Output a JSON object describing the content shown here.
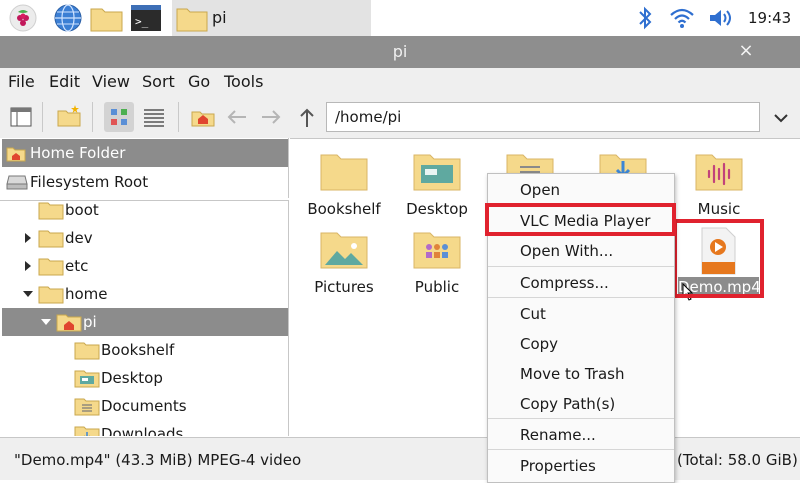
{
  "taskbar": {
    "launcher_icons": [
      "raspberry-icon",
      "web-browser-icon",
      "file-manager-icon",
      "terminal-icon"
    ],
    "open_window": {
      "label": "pi",
      "icon": "folder-icon"
    },
    "tray_icons": [
      "bluetooth-icon",
      "wifi-icon",
      "volume-icon"
    ],
    "clock": "19:43"
  },
  "window": {
    "title": "pi",
    "close_glyph": "×"
  },
  "menubar": {
    "items": [
      "File",
      "Edit",
      "View",
      "Sort",
      "Go",
      "Tools"
    ]
  },
  "toolbar": {
    "path": "/home/pi",
    "buttons": [
      "sidepane-icon",
      "new-folder-icon",
      "icon-view-icon",
      "list-view-icon",
      "home-icon",
      "back-arrow-icon",
      "forward-arrow-icon",
      "up-arrow-icon"
    ],
    "history_dropdown_glyph": "⌄"
  },
  "sidebar": {
    "places": [
      {
        "label": "Home Folder",
        "icon": "home-icon",
        "selected": true
      },
      {
        "label": "Filesystem Root",
        "icon": "drive-icon",
        "selected": false
      }
    ],
    "tree": [
      {
        "label": "boot"
      },
      {
        "label": "dev"
      },
      {
        "label": "etc"
      },
      {
        "label": "home"
      },
      {
        "label": "pi"
      },
      {
        "label": "Bookshelf"
      },
      {
        "label": "Desktop"
      },
      {
        "label": "Documents"
      },
      {
        "label": "Downloads"
      }
    ]
  },
  "files": [
    {
      "label": "Bookshelf",
      "icon": "folder-icon"
    },
    {
      "label": "Desktop",
      "icon": "desktop-folder-icon"
    },
    {
      "label": "Music",
      "icon": "music-folder-icon"
    },
    {
      "label": "Pictures",
      "icon": "pictures-folder-icon"
    },
    {
      "label": "Public",
      "icon": "public-folder-icon"
    },
    {
      "label": "Demo.mp4",
      "icon": "video-file-icon",
      "selected": true
    }
  ],
  "context_menu": {
    "items": [
      "Open",
      "VLC Media Player",
      "Open With...",
      "Compress...",
      "Cut",
      "Copy",
      "Move to Trash",
      "Copy Path(s)",
      "Rename...",
      "Properties"
    ],
    "highlighted": "VLC Media Player"
  },
  "statusbar": {
    "left": "\"Demo.mp4\" (43.3 MiB) MPEG-4 video",
    "right": "(Total: 58.0 GiB)"
  },
  "colors": {
    "selection": "#8c8c8c",
    "highlight_box": "#e0222e",
    "folder": "#f5d98b",
    "titlebar": "#8e8e8e"
  }
}
